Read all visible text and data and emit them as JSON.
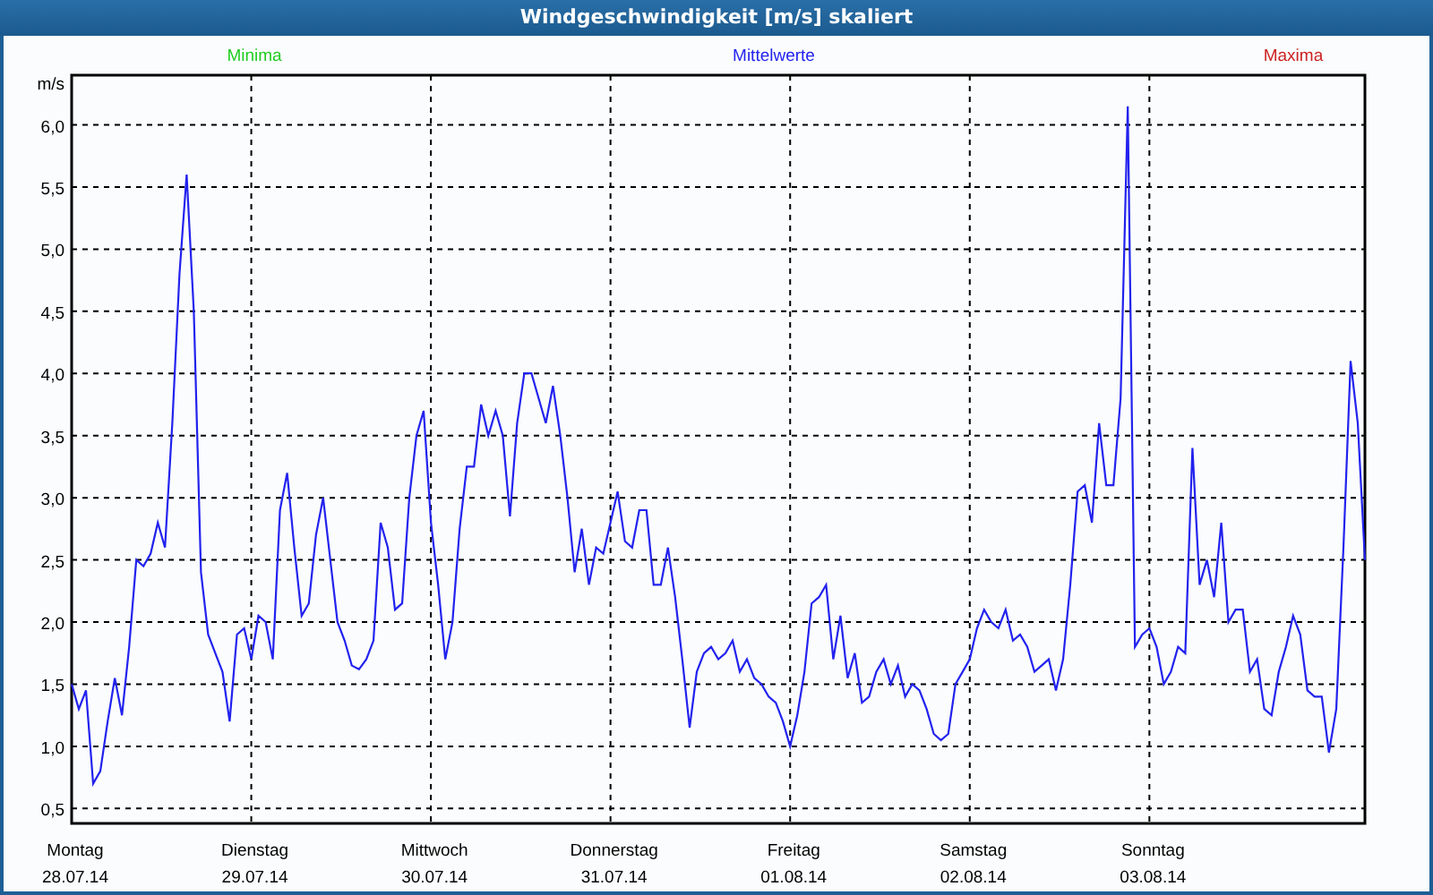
{
  "window": {
    "title": "Windgeschwindigkeit [m/s] skaliert"
  },
  "chart": {
    "legend": [
      {
        "label": "Minima",
        "color": "#22cc22"
      },
      {
        "label": "Maxima",
        "color": "#cc2222"
      }
    ],
    "chart_data": {
      "type": "line",
      "ylabel": "m/s",
      "grid": true,
      "ylim": [
        0.38,
        6.4
      ],
      "categories": [
        "Montag\n28.07.14",
        null,
        null,
        null,
        null,
        null,
        null,
        null,
        null,
        null,
        null,
        null,
        null,
        null,
        null,
        null,
        null,
        null,
        null,
        null,
        null,
        null,
        null,
        null,
        null,
        "Dienstag\n29.07.14",
        null,
        null,
        null,
        null,
        null,
        null,
        null,
        null,
        null,
        null,
        null,
        null,
        null,
        null,
        null,
        null,
        null,
        null,
        null,
        null,
        null,
        null,
        null,
        null,
        "Mittwoch\n30.07.14",
        null,
        null,
        null,
        null,
        null,
        null,
        null,
        null,
        null,
        null,
        null,
        null,
        null,
        null,
        null,
        null,
        null,
        null,
        null,
        null,
        null,
        null,
        null,
        null,
        "Donnerstag\n31.07.14",
        null,
        null,
        null,
        null,
        null,
        null,
        null,
        null,
        null,
        null,
        null,
        null,
        null,
        null,
        null,
        null,
        null,
        null,
        null,
        null,
        null,
        null,
        null,
        null,
        "Freitag\n01.08.14",
        null,
        null,
        null,
        null,
        null,
        null,
        null,
        null,
        null,
        null,
        null,
        null,
        null,
        null,
        null,
        null,
        null,
        null,
        null,
        null,
        null,
        null,
        null,
        null,
        "Samstag\n02.08.14",
        null,
        null,
        null,
        null,
        null,
        null,
        null,
        null,
        null,
        null,
        null,
        null,
        null,
        null,
        null,
        null,
        null,
        null,
        null,
        null,
        null,
        null,
        null,
        null,
        "Sonntag\n03.08.14",
        null,
        null,
        null,
        null,
        null,
        null,
        null,
        null,
        null,
        null,
        null,
        null,
        null,
        null,
        null,
        null,
        null,
        null,
        null,
        null,
        null,
        null,
        null,
        null,
        null,
        null,
        null,
        null,
        null,
        null
      ],
      "yticks": [
        {
          "value": 0.5,
          "label": "0,5"
        },
        {
          "value": 1,
          "label": "1,0"
        },
        {
          "value": 1.5,
          "label": "1,5"
        },
        {
          "value": 2,
          "label": "2,0"
        },
        {
          "value": 2.5,
          "label": "2,5"
        },
        {
          "value": 3,
          "label": "3,0"
        },
        {
          "value": 3.5,
          "label": "3,5"
        },
        {
          "value": 4,
          "label": "4,0"
        },
        {
          "value": 4.5,
          "label": "4,5"
        },
        {
          "value": 5,
          "label": "5,0"
        },
        {
          "value": 5.5,
          "label": "5,5"
        },
        {
          "value": 6,
          "label": "6,0"
        }
      ],
      "series": [
        {
          "name": "Mittelwerte",
          "color": "#2222ee",
          "values": [
            1.5,
            1.3,
            1.45,
            0.7,
            0.8,
            1.2,
            1.55,
            1.25,
            1.8,
            2.5,
            2.45,
            2.55,
            2.8,
            2.6,
            3.6,
            4.8,
            5.6,
            4.5,
            2.4,
            1.9,
            1.75,
            1.6,
            1.2,
            1.9,
            1.95,
            1.7,
            2.05,
            2.0,
            1.7,
            2.9,
            3.2,
            2.6,
            2.05,
            2.15,
            2.7,
            3.0,
            2.5,
            2.0,
            1.85,
            1.65,
            1.62,
            1.7,
            1.85,
            2.8,
            2.6,
            2.1,
            2.15,
            3.0,
            3.5,
            3.7,
            2.8,
            2.3,
            1.7,
            2.0,
            2.75,
            3.25,
            3.25,
            3.75,
            3.5,
            3.7,
            3.5,
            2.85,
            3.6,
            4.0,
            4.0,
            3.8,
            3.6,
            3.9,
            3.5,
            3.0,
            2.4,
            2.75,
            2.3,
            2.6,
            2.55,
            2.8,
            3.05,
            2.65,
            2.6,
            2.9,
            2.9,
            2.3,
            2.3,
            2.6,
            2.2,
            1.7,
            1.15,
            1.6,
            1.75,
            1.8,
            1.7,
            1.75,
            1.85,
            1.6,
            1.7,
            1.55,
            1.5,
            1.4,
            1.35,
            1.2,
            1.0,
            1.25,
            1.6,
            2.15,
            2.2,
            2.3,
            1.7,
            2.05,
            1.55,
            1.75,
            1.35,
            1.4,
            1.6,
            1.7,
            1.5,
            1.65,
            1.4,
            1.5,
            1.45,
            1.3,
            1.1,
            1.05,
            1.1,
            1.5,
            1.6,
            1.7,
            1.95,
            2.1,
            2.0,
            1.95,
            2.1,
            1.85,
            1.9,
            1.8,
            1.6,
            1.65,
            1.7,
            1.45,
            1.7,
            2.3,
            3.05,
            3.1,
            2.8,
            3.6,
            3.1,
            3.1,
            3.8,
            6.15,
            1.8,
            1.9,
            1.95,
            1.8,
            1.5,
            1.6,
            1.8,
            1.75,
            3.4,
            2.3,
            2.5,
            2.2,
            2.8,
            2.0,
            2.1,
            2.1,
            1.6,
            1.7,
            1.3,
            1.25,
            1.6,
            1.8,
            2.05,
            1.9,
            1.45,
            1.4,
            1.4,
            0.95,
            1.3,
            2.6,
            4.1,
            3.6,
            2.5
          ]
        }
      ]
    }
  }
}
